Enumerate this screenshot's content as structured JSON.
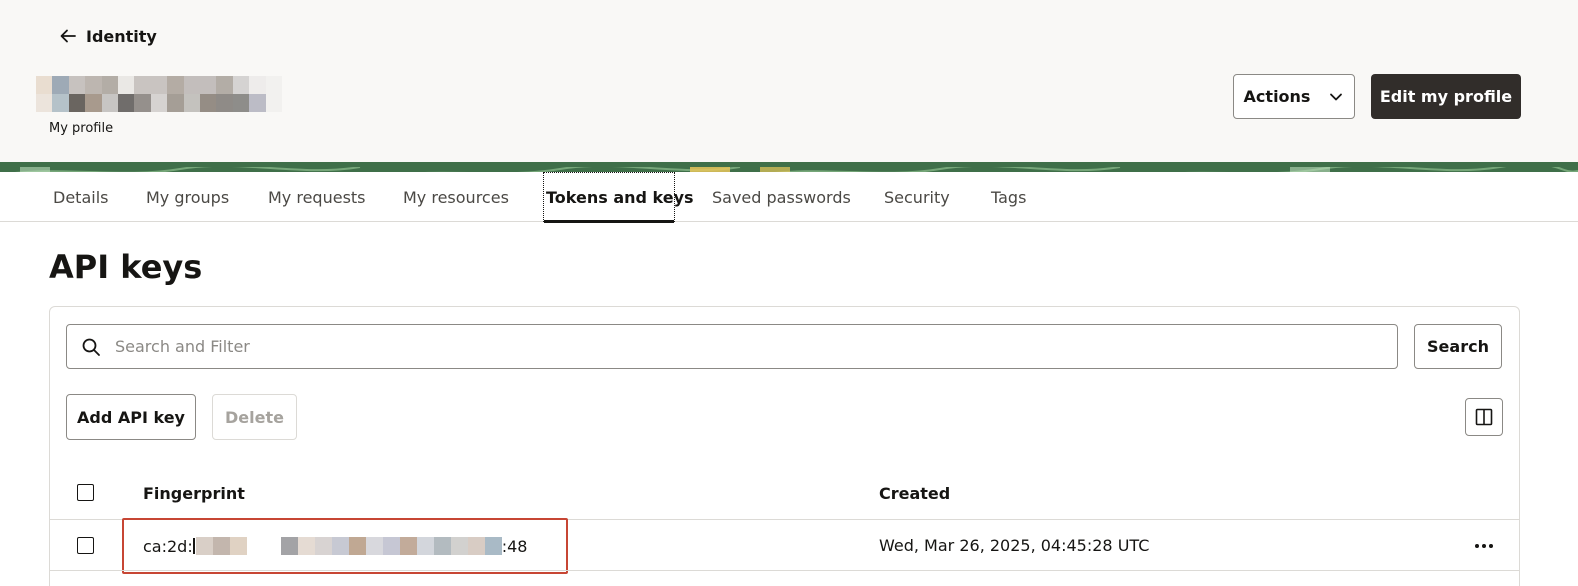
{
  "header": {
    "back_label": "Identity",
    "profile_label": "My profile",
    "actions_label": "Actions",
    "edit_label": "Edit my profile",
    "name_redacted_colors": [
      "#e9ddd0",
      "#9eaab6",
      "#c7c2bf",
      "#bdb6b0",
      "#b3ada6",
      "#eae8e5",
      "#c9c4c1",
      "#c9c4c1",
      "#b4aca4",
      "#c3bebc",
      "#c3bebc",
      "#b3ada6",
      "#d5d3d2",
      "#eeeceb",
      "#f2f1ef",
      "#ece4dc",
      "#b5c2c9",
      "#6a6560",
      "#a89a8d",
      "#c7c5c3",
      "#706d6b",
      "#95908c",
      "#d6d3d1",
      "#a59e96",
      "#c4c2be",
      "#958d85",
      "#8f8b87",
      "#8e8d8a",
      "#bcbcc6",
      "#f2f1ef"
    ]
  },
  "tabs": [
    {
      "label": "Details"
    },
    {
      "label": "My groups"
    },
    {
      "label": "My requests"
    },
    {
      "label": "My resources"
    },
    {
      "label": "Tokens and keys"
    },
    {
      "label": "Saved passwords"
    },
    {
      "label": "Security"
    },
    {
      "label": "Tags"
    }
  ],
  "active_tab": "Tokens and keys",
  "page": {
    "title": "API keys",
    "search_placeholder": "Search and Filter",
    "search_value": "",
    "search_button": "Search",
    "add_button": "Add API key",
    "delete_button": "Delete"
  },
  "table": {
    "columns": [
      "Fingerprint",
      "Created"
    ],
    "rows": [
      {
        "fingerprint_prefix": "ca:2d:",
        "fingerprint_suffix": ":48",
        "created": "Wed, Mar 26, 2025, 04:45:28 UTC",
        "selected": false
      }
    ],
    "fingerprint_redacted_colors": [
      "#d9cfc7",
      "#c3b6ad",
      "#e0d2c3",
      "#ffffff",
      "#ffffff",
      "#a3a3a6",
      "#e5dbd3",
      "#d8d3d2",
      "#c7c9d3",
      "#c0a893",
      "#d8d8dd",
      "#c6c7d4",
      "#c2ab9a",
      "#d3d6dc",
      "#b3bbc0",
      "#d2d1cf",
      "#d8ccc4",
      "#a9bac6"
    ]
  },
  "colors": {
    "primary_button": "#312d2a",
    "highlight_border": "#c74634",
    "banner": "#3f6f49"
  },
  "icons": {
    "back": "arrow-left-icon",
    "actions": "chevron-down-icon",
    "search": "search-icon",
    "columns": "columns-icon",
    "row_menu": "more-horizontal-icon"
  }
}
